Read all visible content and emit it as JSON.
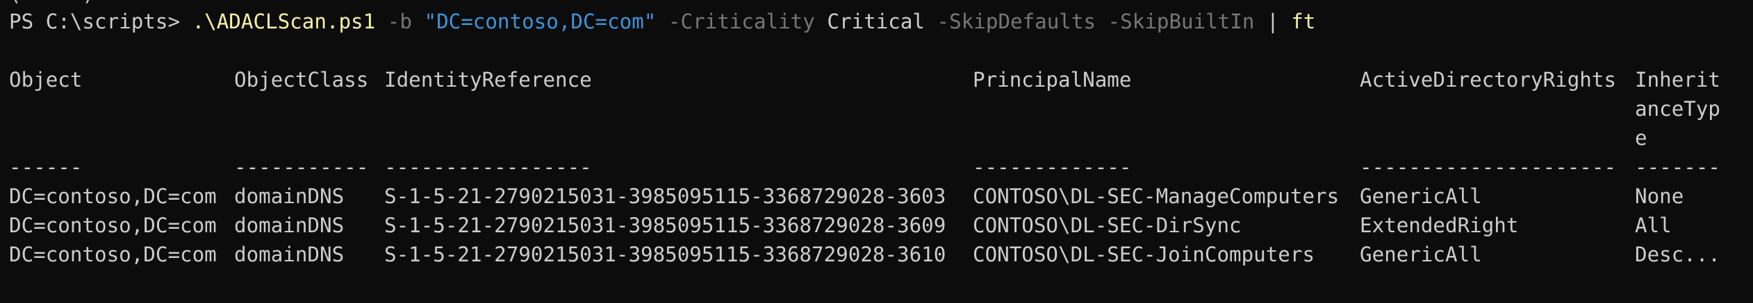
{
  "window": {
    "background": "#0c0c0c",
    "previous_line_fragment": "(     )"
  },
  "command": {
    "prompt": "PS C:\\scripts> ",
    "script": ".\\ADACLScan.ps1",
    "param_b": "-b",
    "dn_string": "\"DC=contoso,DC=com\"",
    "param_criticality": "-Criticality",
    "criticality_value": "Critical",
    "param_skipdefaults": "-SkipDefaults",
    "param_skipbuiltin": "-SkipBuiltIn",
    "pipe": "|",
    "format_cmd": "ft"
  },
  "colors": {
    "command": "#f9f1a5",
    "parameter": "#767676",
    "string": "#3a96dd",
    "text": "#cccccc"
  },
  "table": {
    "headers": {
      "object": "Object",
      "objectclass": "ObjectClass",
      "identityreference": "IdentityReference",
      "principalname": "PrincipalName",
      "adrights": "ActiveDirectoryRights",
      "inheritance_1": "Inherit",
      "inheritance_2": "anceTyp",
      "inheritance_3": "e"
    },
    "separators": {
      "object": "------",
      "objectclass": "-----------",
      "identityreference": "-----------------",
      "principalname": "-------------",
      "adrights": "---------------------",
      "inheritance": "-------"
    },
    "rows": [
      {
        "object": "DC=contoso,DC=com",
        "objectclass": "domainDNS",
        "identityreference": "S-1-5-21-2790215031-3985095115-3368729028-3603",
        "principalname": "CONTOSO\\DL-SEC-ManageComputers",
        "adrights": "GenericAll",
        "inheritance": "None"
      },
      {
        "object": "DC=contoso,DC=com",
        "objectclass": "domainDNS",
        "identityreference": "S-1-5-21-2790215031-3985095115-3368729028-3609",
        "principalname": "CONTOSO\\DL-SEC-DirSync",
        "adrights": "ExtendedRight",
        "inheritance": "All"
      },
      {
        "object": "DC=contoso,DC=com",
        "objectclass": "domainDNS",
        "identityreference": "S-1-5-21-2790215031-3985095115-3368729028-3610",
        "principalname": "CONTOSO\\DL-SEC-JoinComputers",
        "adrights": "GenericAll",
        "inheritance": "Desc..."
      }
    ]
  }
}
